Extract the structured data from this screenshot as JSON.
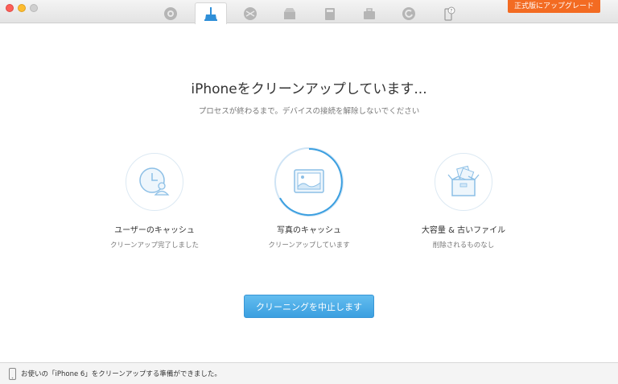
{
  "toolbar": {
    "icons": [
      {
        "name": "airbackup-icon",
        "active": false
      },
      {
        "name": "clean-icon",
        "active": true
      },
      {
        "name": "file-manager-icon",
        "active": false
      },
      {
        "name": "app-manager-icon",
        "active": false
      },
      {
        "name": "media-icon",
        "active": false
      },
      {
        "name": "toolkit-icon",
        "active": false
      },
      {
        "name": "restore-icon",
        "active": false
      },
      {
        "name": "help-icon",
        "active": false
      }
    ],
    "upgrade_label": "正式版にアップグレード"
  },
  "main": {
    "headline": "iPhoneをクリーンアップしています...",
    "subline": "プロセスが終わるまで。デバイスの接続を解除しないでください",
    "steps": [
      {
        "title": "ユーザーのキャッシュ",
        "desc": "クリーンアップ完了しました",
        "icon": "user-clock-icon"
      },
      {
        "title": "写真のキャッシュ",
        "desc": "クリーンアップしています",
        "icon": "photo-icon"
      },
      {
        "title": "大容量 & 古いファイル",
        "desc": "削除されるものなし",
        "icon": "box-icon"
      }
    ],
    "stop_button_label": "クリーニングを中止します"
  },
  "statusbar": {
    "text": "お使いの「iPhone 6」をクリーンアップする準備ができました。"
  },
  "colors": {
    "accent": "#3b9fe0",
    "upgrade": "#f36b22",
    "icon_stroke": "#8cbfe6"
  }
}
